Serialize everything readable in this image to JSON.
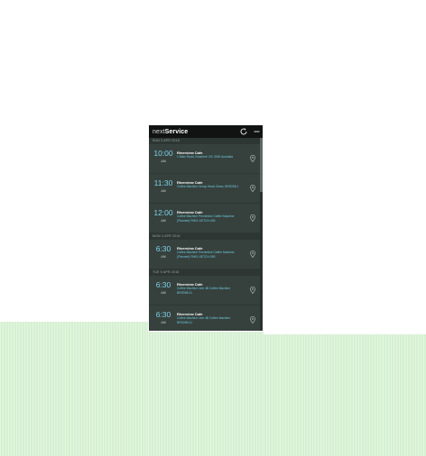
{
  "app": {
    "brand_light": "next",
    "brand_bold": "Service"
  },
  "icons": {
    "refresh": "refresh-icon",
    "menu": "vertical-menu-icon",
    "pin": "map-pin-icon"
  },
  "colors": {
    "accent": "#7fd0e8",
    "panel": "#36413d",
    "bar": "#111312"
  },
  "groups": [
    {
      "date": "SUN 3 APR 2016",
      "items": [
        {
          "time": "10:00",
          "ampm": "AM",
          "name": "Riverview Cafe",
          "address": "1 Main Road, Nowhere VIC 3000 Australia"
        },
        {
          "time": "11:30",
          "ampm": "AM",
          "name": "Riverview Cafe",
          "address": "Coffee Machine Group Head Clean, BRS098-1"
        },
        {
          "time": "12:00",
          "ampm": "AM",
          "name": "Riverview Cafe",
          "address": "Coffee Machine Preventive Coffee Machine (Planned) PM01 KETCH-090"
        }
      ]
    },
    {
      "date": "MON 4 APR 2016",
      "items": [
        {
          "time": "6:30",
          "ampm": "AM",
          "name": "Riverview Cafe",
          "address": "Coffee Machine Preventive Coffee Machine (Planned) PM01 KETCH-090"
        }
      ]
    },
    {
      "date": "TUE 5 APR 2016",
      "items": [
        {
          "time": "6:30",
          "ampm": "AM",
          "name": "Riverview Cafe",
          "address": "Coffee Machine Line 4B Coffee Machine BRS098-01"
        },
        {
          "time": "6:30",
          "ampm": "AM",
          "name": "Riverview Cafe",
          "address": "Coffee Machine Line 4B Coffee Machine BRS098-01"
        }
      ]
    }
  ]
}
